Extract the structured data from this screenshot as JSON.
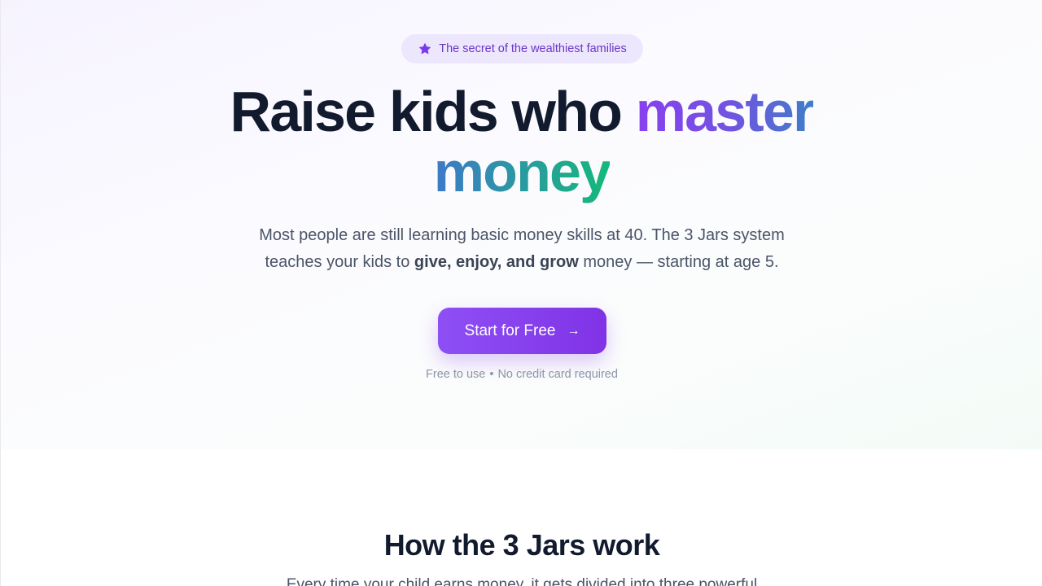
{
  "hero": {
    "badge": {
      "icon": "star-icon",
      "text": "The secret of the wealthiest families",
      "color": "#6b35c9",
      "background": "#ede7fd"
    },
    "headline": {
      "part1": "Raise kids who ",
      "highlight1": "master",
      "highlight2": "money"
    },
    "subtitle": {
      "line1": "Most people are still learning basic money skills at 40. The 3 Jars system",
      "line2_start": "teaches your kids to ",
      "line2_bold": "give, enjoy, and grow",
      "line2_end": " money — starting at age 5."
    },
    "cta": {
      "label": "Start for Free",
      "icon": "arrow-right-icon",
      "arrow": "→",
      "gradient": [
        "#8e4ff5",
        "#8033e6"
      ]
    },
    "note": {
      "part1": "Free to use",
      "separator": "•",
      "part2": "No credit card required"
    }
  },
  "how_it_works": {
    "title": "How the 3 Jars work",
    "subtitle": "Every time your child earns money, it gets divided into three powerful"
  }
}
